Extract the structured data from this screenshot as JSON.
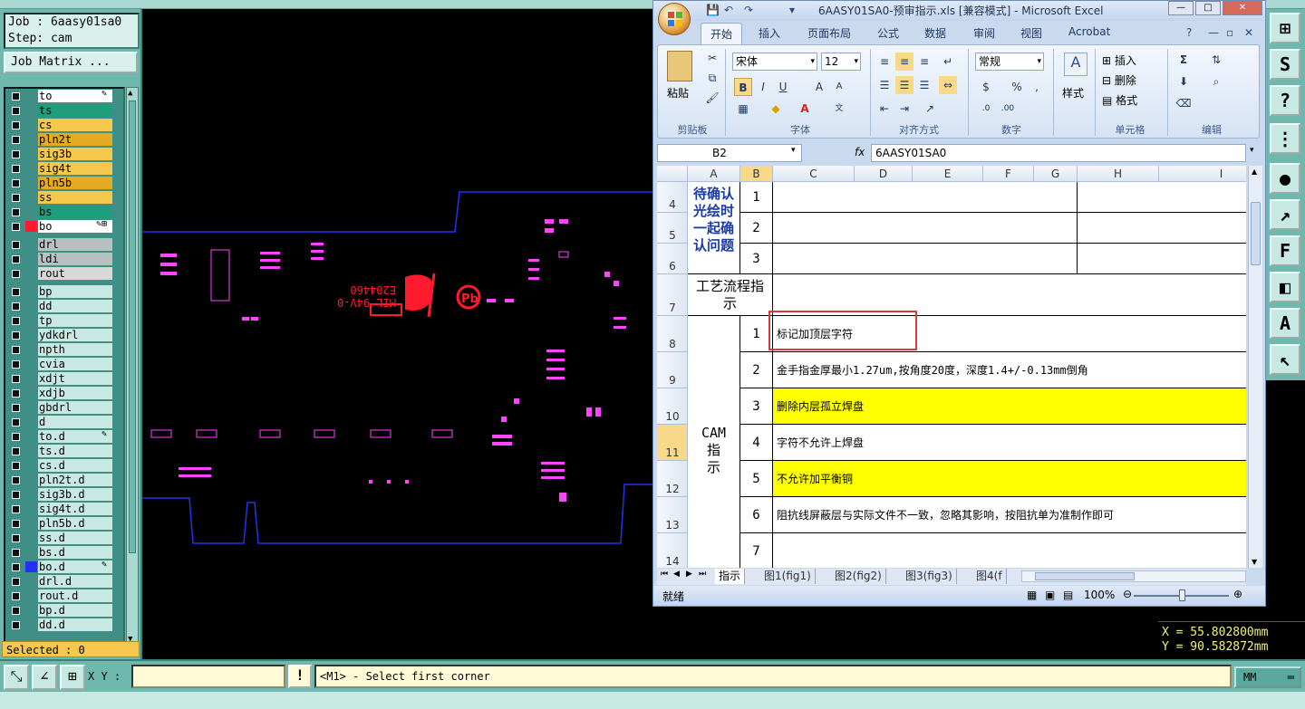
{
  "cam": {
    "job_label": "Job : 6aasy01sa0",
    "step_label": "Step: cam",
    "job_matrix_button": "Job Matrix ...",
    "selected_label": "Selected : 0",
    "xy_label": "X Y :",
    "xy_value": "",
    "exclamation": "!",
    "status_message": "<M1> - Select first corner",
    "units": "MM",
    "coord_x": "X  =  55.802800mm",
    "coord_y": "Y  =  90.582872mm",
    "layers": [
      {
        "name": "to",
        "color": "#ffffff",
        "edit": "✎"
      },
      {
        "name": "ts",
        "color": "#1f9e7a",
        "edit": ""
      },
      {
        "name": "cs",
        "color": "#f5c84d",
        "edit": ""
      },
      {
        "name": "pln2t",
        "color": "#e6aa20",
        "edit": ""
      },
      {
        "name": "sig3b",
        "color": "#f5c84d",
        "edit": ""
      },
      {
        "name": "sig4t",
        "color": "#f5c84d",
        "edit": ""
      },
      {
        "name": "pln5b",
        "color": "#e6aa20",
        "edit": ""
      },
      {
        "name": "ss",
        "color": "#f5c84d",
        "edit": ""
      },
      {
        "name": "bs",
        "color": "#1f9e7a",
        "edit": ""
      },
      {
        "name": "bo",
        "color": "#ffffff",
        "edit": "✎⊞"
      },
      {
        "name": "drl",
        "color": "#b8c0c0",
        "edit": ""
      },
      {
        "name": "ldi",
        "color": "#b8c0c0",
        "edit": ""
      },
      {
        "name": "rout",
        "color": "#d8d8d8",
        "edit": ""
      },
      {
        "name": "bp",
        "color": "#c8e8e2",
        "edit": ""
      },
      {
        "name": "dd",
        "color": "#c8e8e2",
        "edit": ""
      },
      {
        "name": "tp",
        "color": "#c8e8e2",
        "edit": ""
      },
      {
        "name": "ydkdrl",
        "color": "#c8e8e2",
        "edit": ""
      },
      {
        "name": "npth",
        "color": "#c8e8e2",
        "edit": ""
      },
      {
        "name": "cvia",
        "color": "#c8e8e2",
        "edit": ""
      },
      {
        "name": "xdjt",
        "color": "#c8e8e2",
        "edit": ""
      },
      {
        "name": "xdjb",
        "color": "#c8e8e2",
        "edit": ""
      },
      {
        "name": "gbdrl",
        "color": "#c8e8e2",
        "edit": ""
      },
      {
        "name": "d",
        "color": "#c8e8e2",
        "edit": ""
      },
      {
        "name": "to.d",
        "color": "#c8e8e2",
        "edit": "✎"
      },
      {
        "name": "ts.d",
        "color": "#c8e8e2",
        "edit": ""
      },
      {
        "name": "cs.d",
        "color": "#c8e8e2",
        "edit": ""
      },
      {
        "name": "pln2t.d",
        "color": "#c8e8e2",
        "edit": ""
      },
      {
        "name": "sig3b.d",
        "color": "#c8e8e2",
        "edit": ""
      },
      {
        "name": "sig4t.d",
        "color": "#c8e8e2",
        "edit": ""
      },
      {
        "name": "pln5b.d",
        "color": "#c8e8e2",
        "edit": ""
      },
      {
        "name": "ss.d",
        "color": "#c8e8e2",
        "edit": ""
      },
      {
        "name": "bs.d",
        "color": "#c8e8e2",
        "edit": ""
      },
      {
        "name": "bo.d",
        "color": "#c8e8e2",
        "edit": "✎"
      },
      {
        "name": "drl.d",
        "color": "#c8e8e2",
        "edit": ""
      },
      {
        "name": "rout.d",
        "color": "#c8e8e2",
        "edit": ""
      },
      {
        "name": "bp.d",
        "color": "#c8e8e2",
        "edit": ""
      },
      {
        "name": "dd.d",
        "color": "#c8e8e2",
        "edit": ""
      }
    ]
  },
  "excel": {
    "title": "6AASY01SA0-预审指示.xls  [兼容模式] - Microsoft Excel",
    "tabs": [
      "开始",
      "插入",
      "页面布局",
      "公式",
      "数据",
      "审阅",
      "视图",
      "Acrobat"
    ],
    "groups": [
      "剪贴板",
      "字体",
      "对齐方式",
      "数字",
      "样式",
      "单元格",
      "编辑"
    ],
    "paste_label": "粘贴",
    "font_name": "宋体",
    "font_size": "12",
    "number_format": "常规",
    "style_label": "样式",
    "insert_label": "插入",
    "delete_label": "删除",
    "format_label": "格式",
    "name_box": "B2",
    "fx_label": "fx",
    "formula_value": "6AASY01SA0",
    "columns": [
      "A",
      "B",
      "C",
      "D",
      "E",
      "F",
      "G",
      "H",
      "I"
    ],
    "rows": [
      "4",
      "5",
      "6",
      "7",
      "8",
      "9",
      "10",
      "11",
      "12",
      "13",
      "14"
    ],
    "confirm_header": "待确认光绘时一起确认问题",
    "process_header": "工艺流程指示",
    "cam_header": "CAM指示",
    "confirm_nums": [
      "1",
      "2",
      "3"
    ],
    "cam_nums": [
      "1",
      "2",
      "3",
      "4",
      "5",
      "6",
      "7"
    ],
    "cam_items": [
      "标记加顶层字符",
      "金手指金厚最小1.27um,按角度20度，深度1.4+/-0.13mm倒角",
      "删除内层孤立焊盘",
      "字符不允许上焊盘",
      "不允许加平衡铜",
      "阻抗线屏蔽层与实际文件不一致，忽略其影响，按阻抗单为准制作即可",
      ""
    ],
    "sheet_tabs": [
      "指示",
      "图1(fig1)",
      "图2(fig2)",
      "图3(fig3)",
      "图4(f"
    ],
    "status_ready": "就绪",
    "zoom": "100%"
  }
}
